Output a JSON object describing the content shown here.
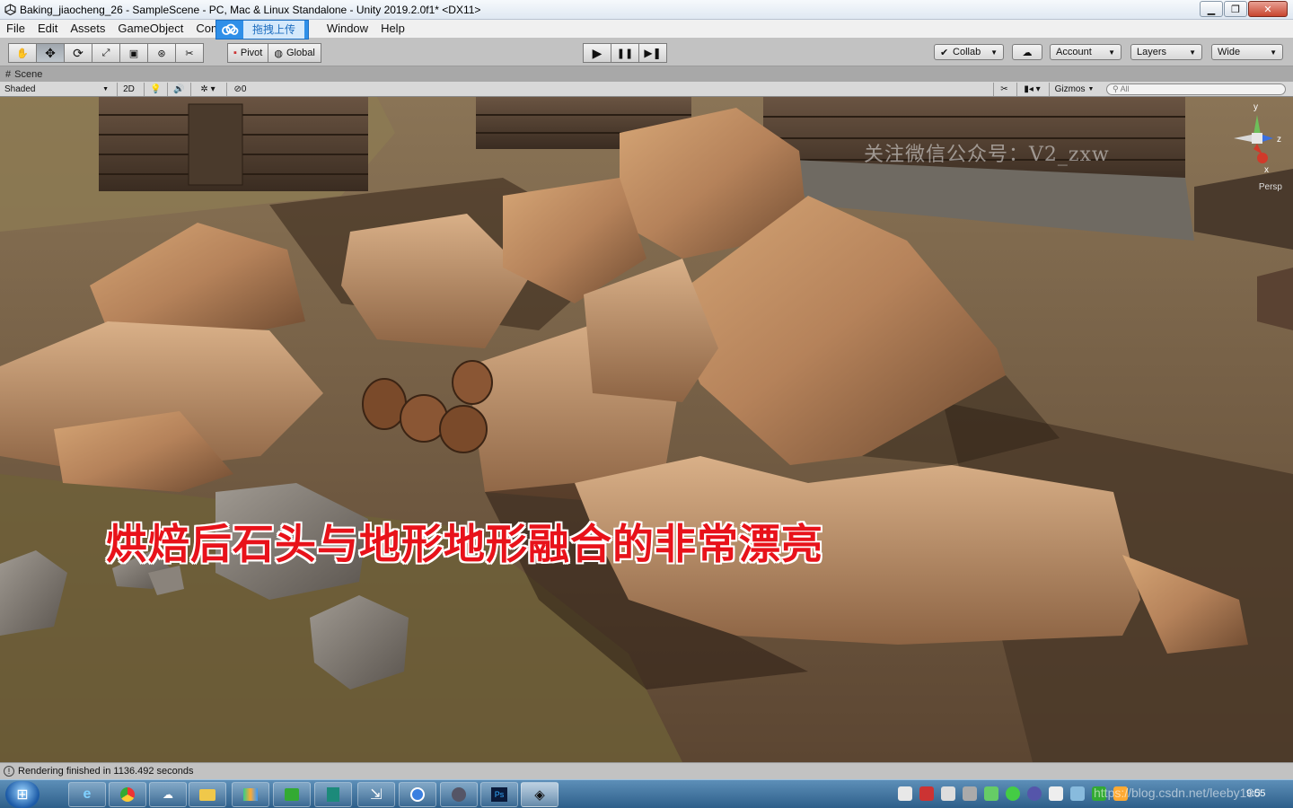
{
  "window": {
    "title": "Baking_jiaocheng_26 - SampleScene - PC, Mac & Linux Standalone - Unity 2019.2.0f1* <DX11>",
    "controls": [
      "minimize",
      "maximize",
      "close"
    ]
  },
  "menu": {
    "items": [
      "File",
      "Edit",
      "Assets",
      "GameObject",
      "Com",
      "Window",
      "Help"
    ],
    "upload_overlay_label": "拖拽上传"
  },
  "toolbar": {
    "transform_tools": [
      "hand-tool",
      "move-tool",
      "rotate-tool",
      "scale-tool",
      "rect-tool",
      "transform-tool",
      "custom-tool"
    ],
    "pivot_label": "Pivot",
    "global_label": "Global",
    "collab_label": "Collab",
    "account_label": "Account",
    "layers_label": "Layers",
    "layout_label": "Wide"
  },
  "scene": {
    "tab_label": "Scene",
    "shading_mode": "Shaded",
    "mode_2d": "2D",
    "hidden_count": "0",
    "gizmos_label": "Gizmos",
    "search_placeholder": "All",
    "projection_label": "Persp",
    "axis_labels": {
      "y": "y",
      "z": "z",
      "x": "x"
    }
  },
  "overlay": {
    "watermark": "关注微信公众号：V2_zxw",
    "caption": "烘焙后石头与地形地形融合的非常漂亮"
  },
  "status": {
    "message": "Rendering finished in 1136.492 seconds"
  },
  "taskbar": {
    "tray_url": "https://blog.csdn.net/leeby100",
    "clock": "9:55"
  }
}
